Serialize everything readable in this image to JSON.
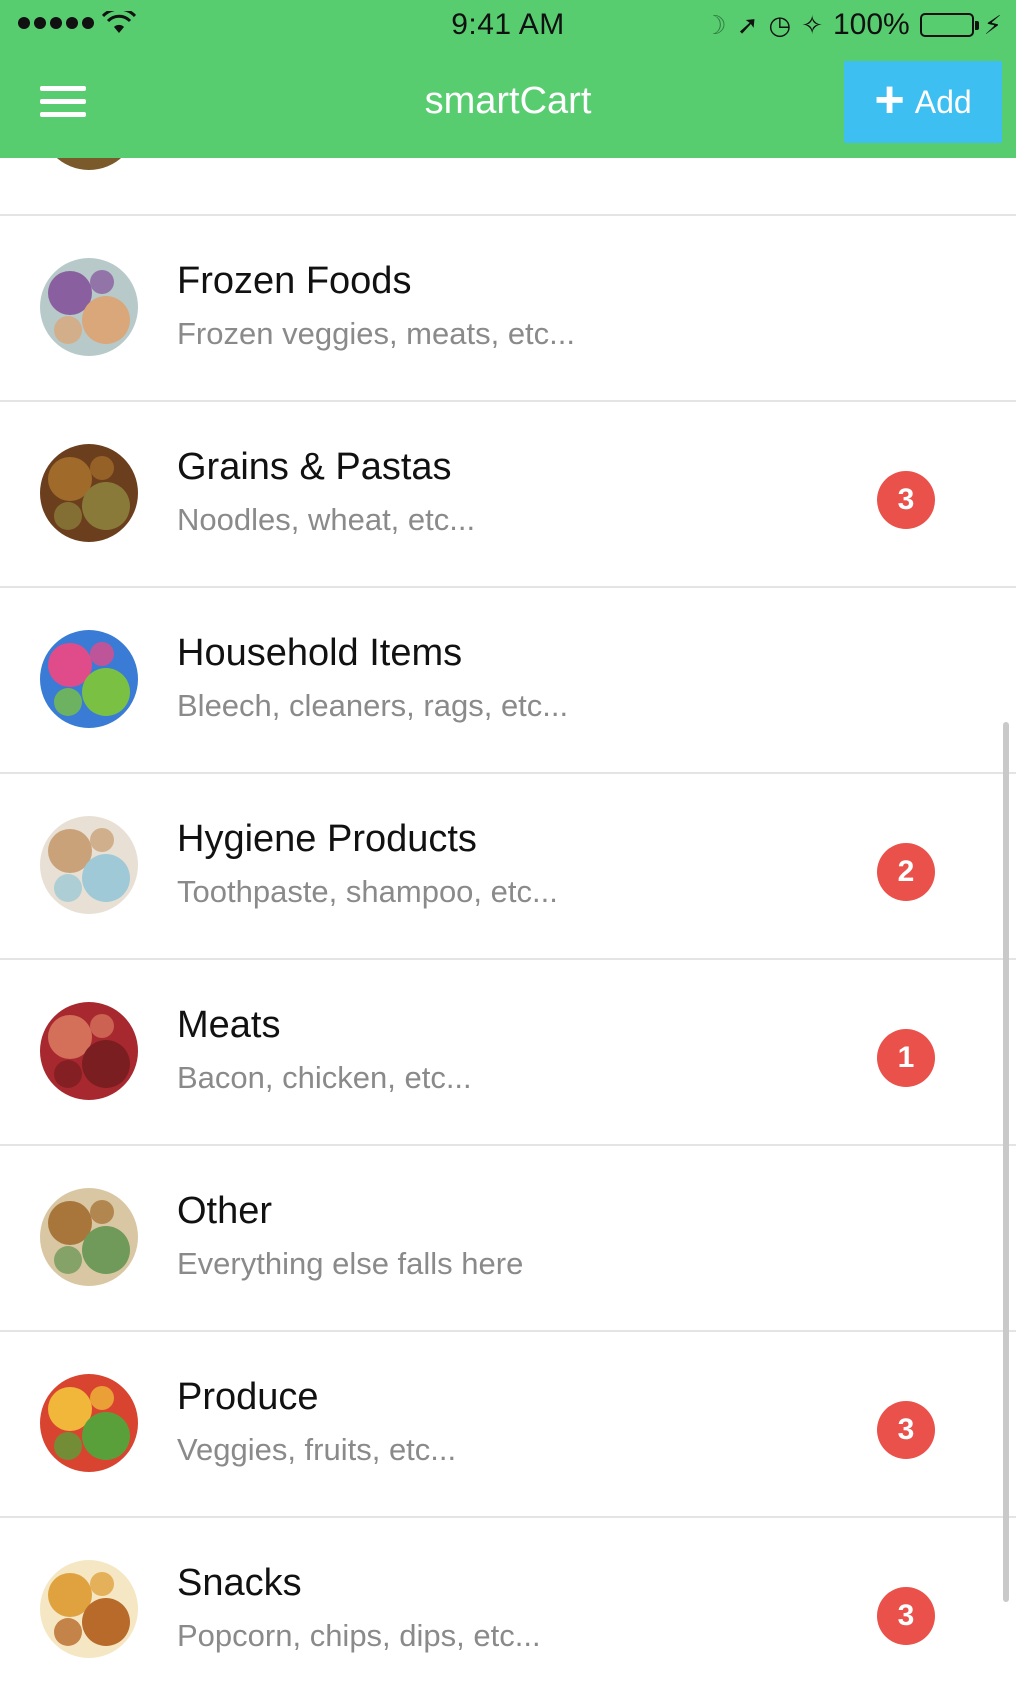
{
  "status_bar": {
    "time": "9:41 AM",
    "battery": "100%"
  },
  "nav": {
    "title": "smartCart",
    "add_label": "Add"
  },
  "categories": [
    {
      "name": "",
      "description": "",
      "badge": null,
      "colors": [
        "#7a5a2a",
        "#c28a3a",
        "#a8b040"
      ]
    },
    {
      "name": "Frozen Foods",
      "description": "Frozen veggies, meats, etc...",
      "badge": null,
      "colors": [
        "#b8c9c9",
        "#8a5fa0",
        "#d9a77a"
      ]
    },
    {
      "name": "Grains & Pastas",
      "description": "Noodles, wheat, etc...",
      "badge": "3",
      "colors": [
        "#6b3f1d",
        "#a06a2a",
        "#8a7a3a"
      ]
    },
    {
      "name": "Household Items",
      "description": "Bleech, cleaners, rags, etc...",
      "badge": null,
      "colors": [
        "#3a7bd5",
        "#e04c8a",
        "#7ac143"
      ]
    },
    {
      "name": "Hygiene Products",
      "description": "Toothpaste, shampoo, etc...",
      "badge": "2",
      "colors": [
        "#e8e0d4",
        "#c9a27a",
        "#9fc9d6"
      ]
    },
    {
      "name": "Meats",
      "description": "Bacon, chicken, etc...",
      "badge": "1",
      "colors": [
        "#a8282f",
        "#d4705a",
        "#7a1e22"
      ]
    },
    {
      "name": "Other",
      "description": "Everything else falls here",
      "badge": null,
      "colors": [
        "#d9c7a4",
        "#a8753a",
        "#6f9a5a"
      ]
    },
    {
      "name": "Produce",
      "description": "Veggies, fruits, etc...",
      "badge": "3",
      "colors": [
        "#d8442f",
        "#f0b73a",
        "#5aa03a"
      ]
    },
    {
      "name": "Snacks",
      "description": "Popcorn, chips, dips, etc...",
      "badge": "3",
      "colors": [
        "#f5e7c4",
        "#e0a23e",
        "#b86a2a"
      ]
    }
  ],
  "colors": {
    "header": "#58cd70",
    "add_button": "#3ebff2",
    "badge": "#e9514a"
  }
}
